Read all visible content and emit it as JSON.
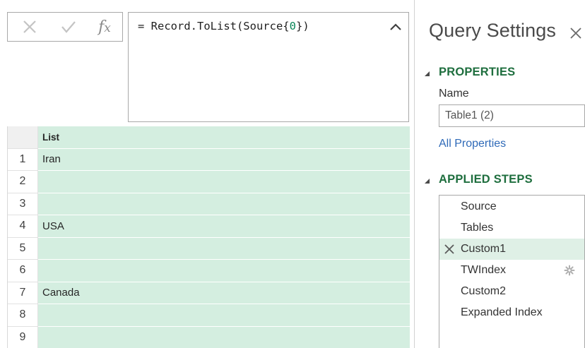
{
  "formula": {
    "prefix": "= Record.ToList(Source{",
    "index": "0",
    "suffix": "})",
    "fx_f": "f",
    "fx_x": "x"
  },
  "grid": {
    "column_header": "List",
    "rows": [
      {
        "num": "1",
        "value": "Iran"
      },
      {
        "num": "2",
        "value": ""
      },
      {
        "num": "3",
        "value": ""
      },
      {
        "num": "4",
        "value": "USA"
      },
      {
        "num": "5",
        "value": ""
      },
      {
        "num": "6",
        "value": ""
      },
      {
        "num": "7",
        "value": "Canada"
      },
      {
        "num": "8",
        "value": ""
      },
      {
        "num": "9",
        "value": ""
      }
    ]
  },
  "query_settings": {
    "title": "Query Settings",
    "properties_heading": "PROPERTIES",
    "name_label": "Name",
    "name_value": "Table1 (2)",
    "all_properties": "All Properties",
    "applied_steps_heading": "APPLIED STEPS",
    "steps": [
      {
        "label": "Source"
      },
      {
        "label": "Tables"
      },
      {
        "label": "Custom1"
      },
      {
        "label": "TWIndex"
      },
      {
        "label": "Custom2"
      },
      {
        "label": "Expanded Index"
      }
    ]
  },
  "colors": {
    "accent_green": "#1e6e3e",
    "grid_fill": "#d4eee0",
    "link_blue": "#2f6ab8"
  }
}
